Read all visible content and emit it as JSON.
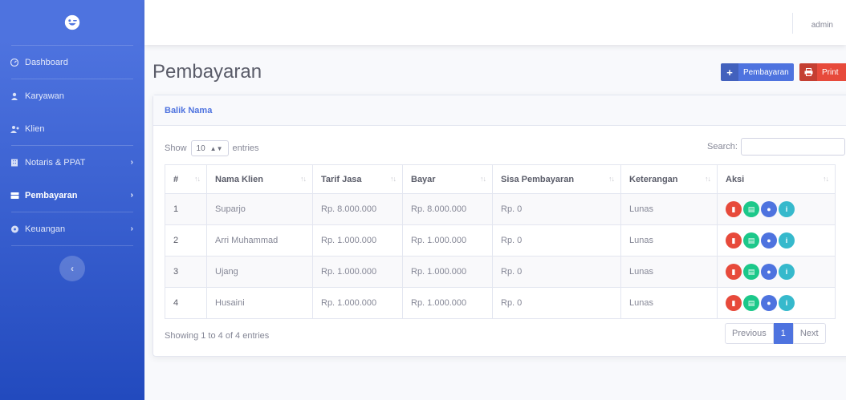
{
  "topbar": {
    "user": "admin"
  },
  "sidebar": {
    "items": [
      {
        "label": "Dashboard",
        "icon": "dashboard-icon"
      },
      {
        "label": "Karyawan",
        "icon": "user-icon"
      },
      {
        "label": "Klien",
        "icon": "users-icon"
      },
      {
        "label": "Notaris & PPAT",
        "icon": "building-icon"
      },
      {
        "label": "Pembayaran",
        "icon": "money-icon"
      },
      {
        "label": "Keuangan",
        "icon": "wallet-icon"
      }
    ]
  },
  "page": {
    "title": "Pembayaran",
    "add_button": "Pembayaran",
    "print_button": "Print"
  },
  "card": {
    "title": "Balik Nama",
    "show_label": "Show",
    "entries_value": "10",
    "entries_label": "entries",
    "search_label": "Search:",
    "info": "Showing 1 to 4 of 4 entries",
    "pagination": {
      "prev": "Previous",
      "current": "1",
      "next": "Next"
    }
  },
  "table": {
    "columns": [
      "#",
      "Nama Klien",
      "Tarif Jasa",
      "Bayar",
      "Sisa Pembayaran",
      "Keterangan",
      "Aksi"
    ],
    "rows": [
      [
        "1",
        "Suparjo",
        "Rp. 8.000.000",
        "Rp. 8.000.000",
        "Rp. 0",
        "Lunas"
      ],
      [
        "2",
        "Arri Muhammad",
        "Rp. 1.000.000",
        "Rp. 1.000.000",
        "Rp. 0",
        "Lunas"
      ],
      [
        "3",
        "Ujang",
        "Rp. 1.000.000",
        "Rp. 1.000.000",
        "Rp. 0",
        "Lunas"
      ],
      [
        "4",
        "Husaini",
        "Rp. 1.000.000",
        "Rp. 1.000.000",
        "Rp. 0",
        "Lunas"
      ]
    ]
  },
  "colors": {
    "primary": "#4e73df",
    "danger": "#e74a3b",
    "success": "#1cc88a",
    "info": "#36b9cc"
  }
}
